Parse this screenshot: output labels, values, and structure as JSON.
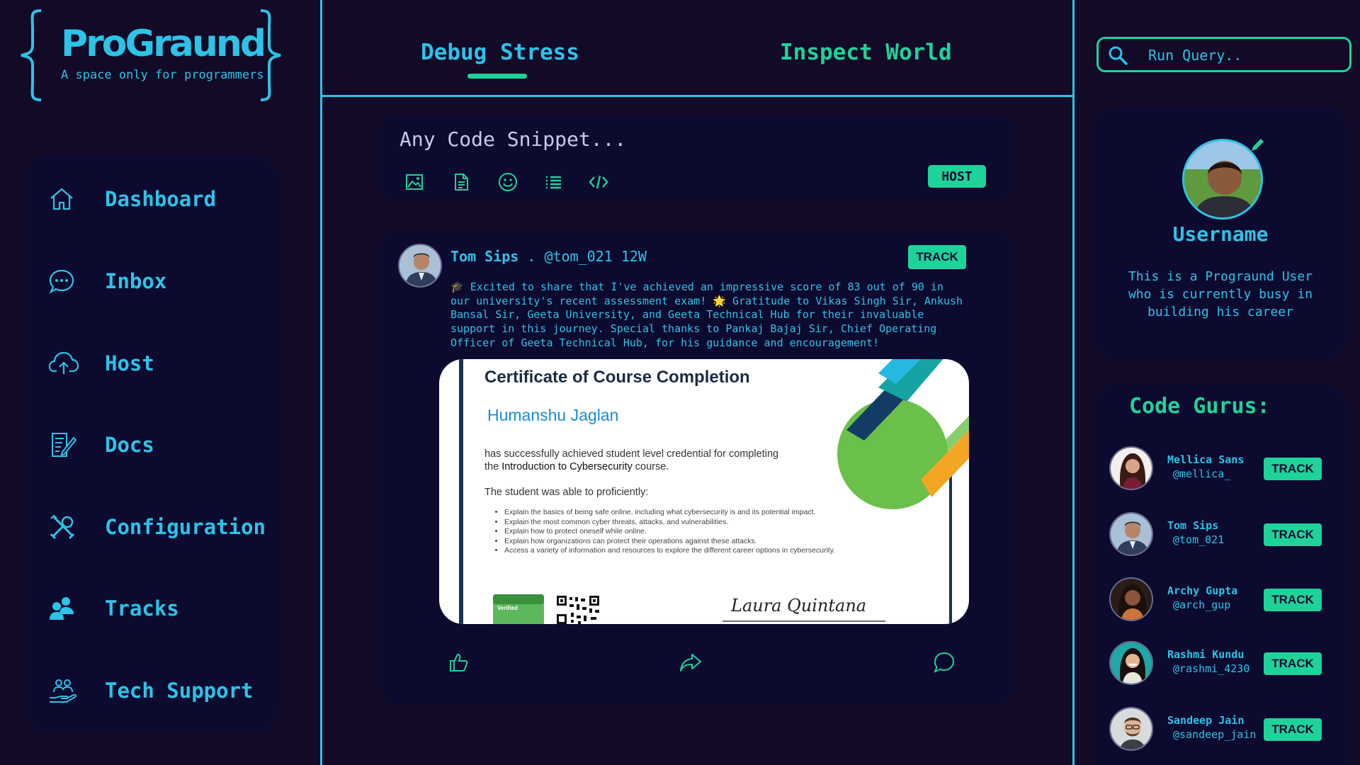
{
  "brand": {
    "title": "ProGraund",
    "tagline": "A space only for programmers"
  },
  "colors": {
    "background": "#120a26",
    "panel": "#0c0a2e",
    "cyan": "#2cc3e8",
    "green": "#1ed39a"
  },
  "sidebar": {
    "items": [
      {
        "label": "Dashboard",
        "icon": "home-icon"
      },
      {
        "label": "Inbox",
        "icon": "chat-bubble-icon"
      },
      {
        "label": "Host",
        "icon": "cloud-upload-icon"
      },
      {
        "label": "Docs",
        "icon": "document-edit-icon"
      },
      {
        "label": "Configuration",
        "icon": "tools-icon"
      },
      {
        "label": "Tracks",
        "icon": "users-icon"
      },
      {
        "label": "Tech Support",
        "icon": "support-hand-icon"
      }
    ]
  },
  "tabs": [
    {
      "label": "Debug Stress",
      "active": true
    },
    {
      "label": "Inspect World",
      "active": false
    }
  ],
  "composer": {
    "placeholder": "Any Code Snippet...",
    "tools": [
      "image-icon",
      "file-icon",
      "emoji-icon",
      "list-icon",
      "code-icon"
    ],
    "host_label": "HOST"
  },
  "post": {
    "author": "Tom Sips",
    "meta": ". @tom_021 12W",
    "track_label": "TRACK",
    "text": "🎓 Excited to share that I've achieved an impressive score of 83 out of 90 in our university's recent assessment exam! 🌟 Gratitude to Vikas Singh Sir, Ankush Bansal Sir, Geeta University, and Geeta Technical Hub for their invaluable support in this journey. Special thanks to Pankaj Bajaj Sir, Chief Operating Officer of Geeta Technical Hub, for his guidance and encouragement!",
    "certificate": {
      "title": "Certificate of Course Completion",
      "recipient": "Humanshu Jaglan",
      "line1": "has successfully achieved student level credential for completing",
      "line2_prefix": "the ",
      "line2_course": "Introduction to Cybersecurity",
      "line2_suffix": " course.",
      "able": "The student was able to proficiently:",
      "bullets": [
        "Explain the basics of being safe online, including what cybersecurity is and its potential impact.",
        "Explain the most common cyber threats, attacks, and vulnerabilities.",
        "Explain how to protect oneself while online.",
        "Explain how organizations can protect their operations against these attacks.",
        "Access a variety of information and resources to explore the different career options in cybersecurity."
      ],
      "badge": "Verified",
      "signature": "Laura Quintana"
    },
    "reactions": [
      "like-icon",
      "share-icon",
      "comment-icon"
    ]
  },
  "search": {
    "placeholder": "Run Query.."
  },
  "profile": {
    "username": "Username",
    "bio": "This is a Prograund User who is currently busy in building his career"
  },
  "gurus": {
    "title": "Code Gurus:",
    "track_label": "TRACK",
    "items": [
      {
        "name": "Mellica Sans",
        "handle": "@mellica_"
      },
      {
        "name": "Tom Sips",
        "handle": "@tom_021"
      },
      {
        "name": "Archy Gupta",
        "handle": "@arch_gup"
      },
      {
        "name": "Rashmi Kundu",
        "handle": "@rashmi_4230"
      },
      {
        "name": "Sandeep Jain",
        "handle": "@sandeep_jain"
      }
    ]
  }
}
